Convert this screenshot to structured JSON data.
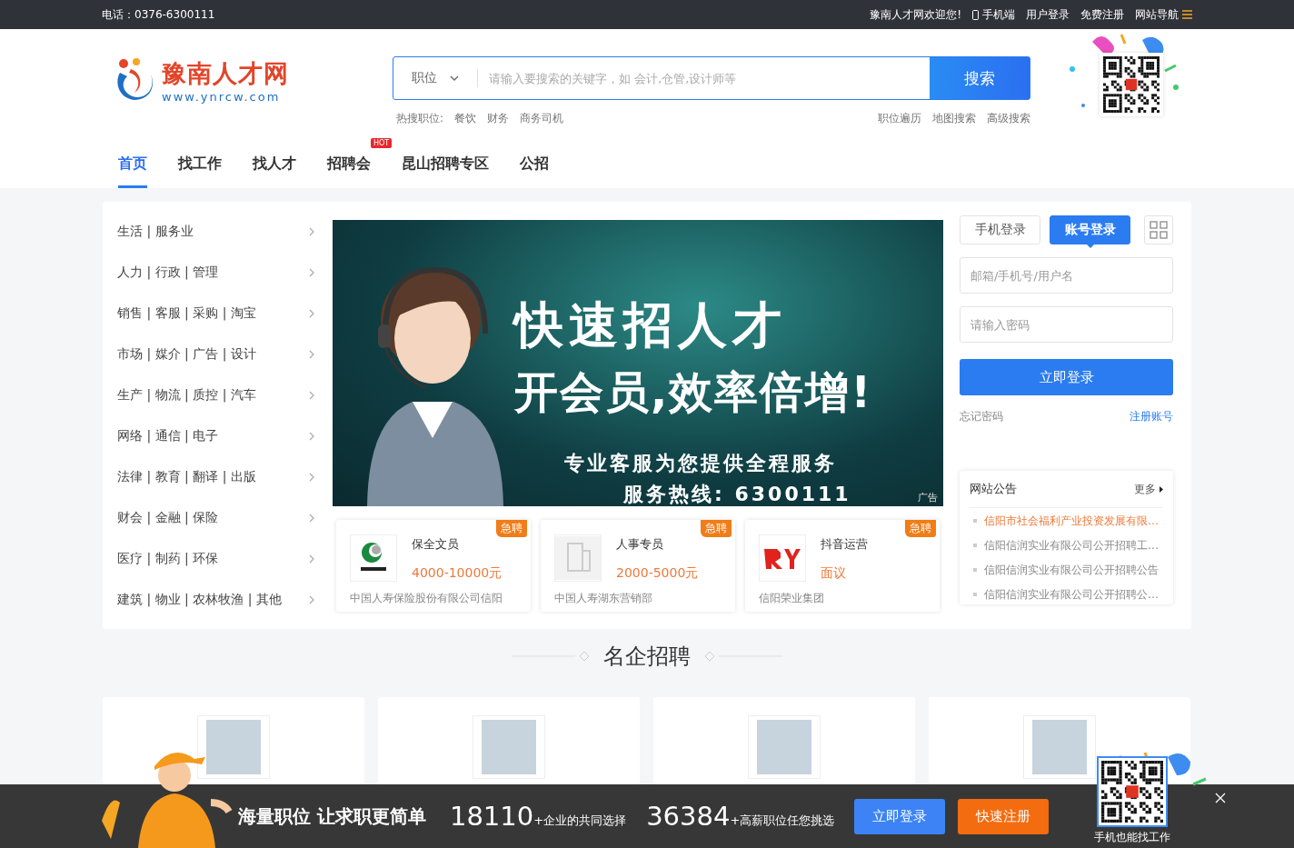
{
  "topbar": {
    "phone": "电话：0376-6300111",
    "welcome": "豫南人才网欢迎您!",
    "links": [
      "手机端",
      "用户登录",
      "免费注册",
      "网站导航"
    ]
  },
  "logo": {
    "name": "豫南人才网",
    "url": "www.ynrcw.com"
  },
  "search": {
    "category": "职位",
    "placeholder": "请输入要搜索的关键字，如 会计,仓管,设计师等",
    "button": "搜索",
    "hot_label": "热搜职位:",
    "hot": [
      "餐饮",
      "财务",
      "商务司机"
    ],
    "links": [
      "职位遍历",
      "地图搜索",
      "高级搜索"
    ]
  },
  "nav": [
    {
      "label": "首页",
      "selected": true
    },
    {
      "label": "找工作",
      "selected": false
    },
    {
      "label": "找人才",
      "selected": false
    },
    {
      "label": "招聘会",
      "selected": false,
      "badge": "HOT"
    },
    {
      "label": "昆山招聘专区",
      "selected": false
    },
    {
      "label": "公招",
      "selected": false
    }
  ],
  "categories": [
    "生活 | 服务业",
    "人力 | 行政 | 管理",
    "销售 | 客服 | 采购 | 淘宝",
    "市场 | 媒介 | 广告 | 设计",
    "生产 | 物流 | 质控 | 汽车",
    "网络 | 通信 | 电子",
    "法律 | 教育 | 翻译 | 出版",
    "财会 | 金融 | 保险",
    "医疗 | 制药 | 环保",
    "建筑 | 物业 | 农林牧渔 | 其他"
  ],
  "banner": {
    "headline": "快速招人才",
    "subline": "开会员,效率倍增!",
    "service": "专业客服为您提供全程服务",
    "hotline": "服务热线: 6300111",
    "ad_label": "广告"
  },
  "jobs": [
    {
      "title": "保全文员",
      "salary": "4000-10000元",
      "company": "中国人寿保险股份有限公司信阳",
      "badge": "急聘",
      "kind": "circle"
    },
    {
      "title": "人事专员",
      "salary": "2000-5000元",
      "company": "中国人寿湖东营销部",
      "badge": "急聘",
      "kind": "building"
    },
    {
      "title": "抖音运营",
      "salary": "面议",
      "company": "信阳荣业集团",
      "badge": "急聘",
      "kind": "letters"
    }
  ],
  "login": {
    "tabs": [
      {
        "label": "手机登录",
        "selected": false
      },
      {
        "label": "账号登录",
        "selected": true
      }
    ],
    "username_placeholder": "邮箱/手机号/用户名",
    "password_placeholder": "请输入密码",
    "submit": "立即登录",
    "forgot": "忘记密码",
    "register": "注册账号"
  },
  "notices": {
    "title": "网站公告",
    "more": "更多",
    "items": [
      {
        "text": "信阳市社会福利产业投资发展有限…",
        "highlighted": true
      },
      {
        "text": "信阳信润实业有限公司公开招聘工…",
        "highlighted": false
      },
      {
        "text": "信阳信润实业有限公司公开招聘公告",
        "highlighted": false
      },
      {
        "text": "信阳信润实业有限公司公开招聘公…",
        "highlighted": false
      }
    ]
  },
  "section_title": "名企招聘",
  "companies": [
    {
      "kind": "photo"
    },
    {
      "kind": "photo"
    },
    {
      "kind": "photo"
    },
    {
      "kind": "photo"
    }
  ],
  "footer_bar": {
    "slogan": "海量职位 让求职更简单",
    "stats": [
      {
        "number": "18110",
        "caption": "+企业的共同选择"
      },
      {
        "number": "36384",
        "caption": "+高薪职位任您挑选"
      }
    ],
    "login": "立即登录",
    "register": "快速注册",
    "qr_caption": "手机也能找工作"
  }
}
